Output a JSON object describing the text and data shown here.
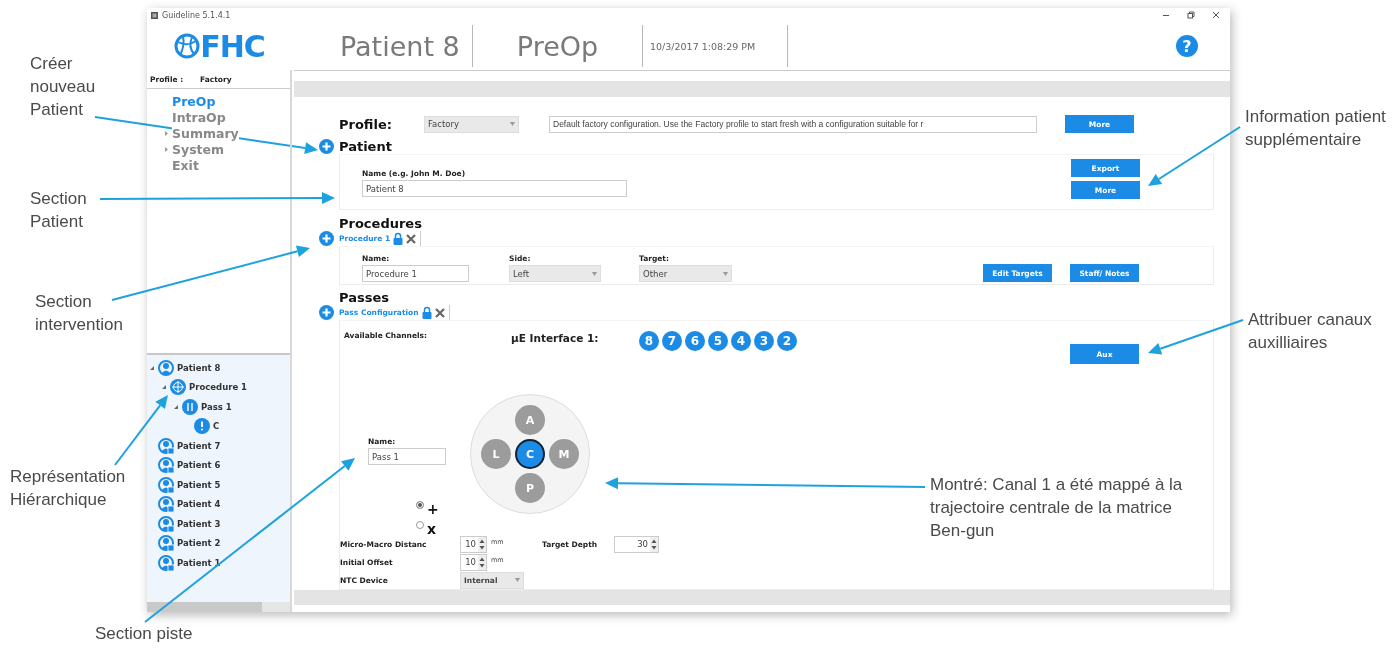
{
  "window": {
    "title": "Guideline 5.1.4.1"
  },
  "header": {
    "logo": "FHC",
    "patient": "Patient 8",
    "phase": "PreOp",
    "datetime": "10/3/2017 1:08:29 PM",
    "help": "?"
  },
  "sidebar": {
    "profile_label": "Profile :",
    "profile_value": "Factory",
    "nav": [
      {
        "label": "PreOp",
        "selected": true,
        "expandable": false
      },
      {
        "label": "IntraOp",
        "selected": false,
        "expandable": false
      },
      {
        "label": "Summary",
        "selected": false,
        "expandable": true
      },
      {
        "label": "System",
        "selected": false,
        "expandable": true
      },
      {
        "label": "Exit",
        "selected": false,
        "expandable": false
      }
    ],
    "tree": [
      {
        "label": "Patient 8",
        "kind": "patient",
        "locked": false,
        "expanded": true,
        "children": [
          {
            "label": "Procedure 1",
            "kind": "procedure",
            "expanded": true,
            "children": [
              {
                "label": "Pass 1",
                "kind": "pass",
                "expanded": true,
                "children": [
                  {
                    "label": "C",
                    "kind": "trajectory"
                  }
                ]
              }
            ]
          }
        ]
      },
      {
        "label": "Patient 7",
        "kind": "patient",
        "locked": true
      },
      {
        "label": "Patient 6",
        "kind": "patient",
        "locked": true
      },
      {
        "label": "Patient 5",
        "kind": "patient",
        "locked": true
      },
      {
        "label": "Patient 4",
        "kind": "patient",
        "locked": true
      },
      {
        "label": "Patient 3",
        "kind": "patient",
        "locked": true
      },
      {
        "label": "Patient 2",
        "kind": "patient",
        "locked": true
      },
      {
        "label": "Patient 1",
        "kind": "patient",
        "locked": true
      }
    ]
  },
  "profile": {
    "label": "Profile:",
    "value": "Factory",
    "description": "Default factory configuration. Use the Factory profile to start fresh with a configuration suitable for r",
    "button": "More"
  },
  "patient": {
    "title": "Patient",
    "name_label": "Name (e.g. John M. Doe)",
    "name_value": "Patient 8",
    "buttons": [
      "Export",
      "More"
    ]
  },
  "procedures": {
    "title": "Procedures",
    "tab": "Procedure 1",
    "fields": [
      {
        "label": "Name:",
        "value": "Procedure 1",
        "kind": "text"
      },
      {
        "label": "Side:",
        "value": "Left",
        "kind": "select"
      },
      {
        "label": "Target:",
        "value": "Other",
        "kind": "select"
      }
    ],
    "buttons": [
      "Edit Targets",
      "Staff/ Notes"
    ]
  },
  "passes": {
    "title": "Passes",
    "tab": "Pass Configuration",
    "channels_label": "Available Channels:",
    "interface_label": "µE Interface 1:",
    "channels": [
      "8",
      "7",
      "6",
      "5",
      "4",
      "3",
      "2"
    ],
    "aux_button": "Aux",
    "name_label": "Name:",
    "name_value": "Pass 1",
    "orientations": [
      {
        "label": "+",
        "selected": true
      },
      {
        "label": "x",
        "selected": false
      }
    ],
    "electrodes": [
      {
        "label": "A",
        "selected": false
      },
      {
        "label": "L",
        "selected": false
      },
      {
        "label": "C",
        "selected": true
      },
      {
        "label": "M",
        "selected": false
      },
      {
        "label": "P",
        "selected": false
      }
    ],
    "settings": [
      {
        "label": "Micro-Macro Distanc",
        "value": "10",
        "unit": "mm",
        "kind": "spin"
      },
      {
        "label": "Target Depth",
        "value": "30",
        "kind": "spin"
      },
      {
        "label": "Initial Offset",
        "value": "10",
        "unit": "mm",
        "kind": "spin"
      },
      {
        "label": "NTC Device",
        "value": "Internal",
        "kind": "select"
      }
    ]
  },
  "annotations": [
    {
      "text": "Créer nouveau Patient"
    },
    {
      "text": "Section Patient"
    },
    {
      "text": "Section intervention"
    },
    {
      "text": "Représentation Hiérarchique"
    },
    {
      "text": "Section piste"
    },
    {
      "text": "Information patient supplémentaire"
    },
    {
      "text": "Attribuer canaux auxilliaires"
    },
    {
      "text": "Montré: Canal 1 a été mappé à la trajectoire centrale de la matrice Ben-gun"
    }
  ]
}
